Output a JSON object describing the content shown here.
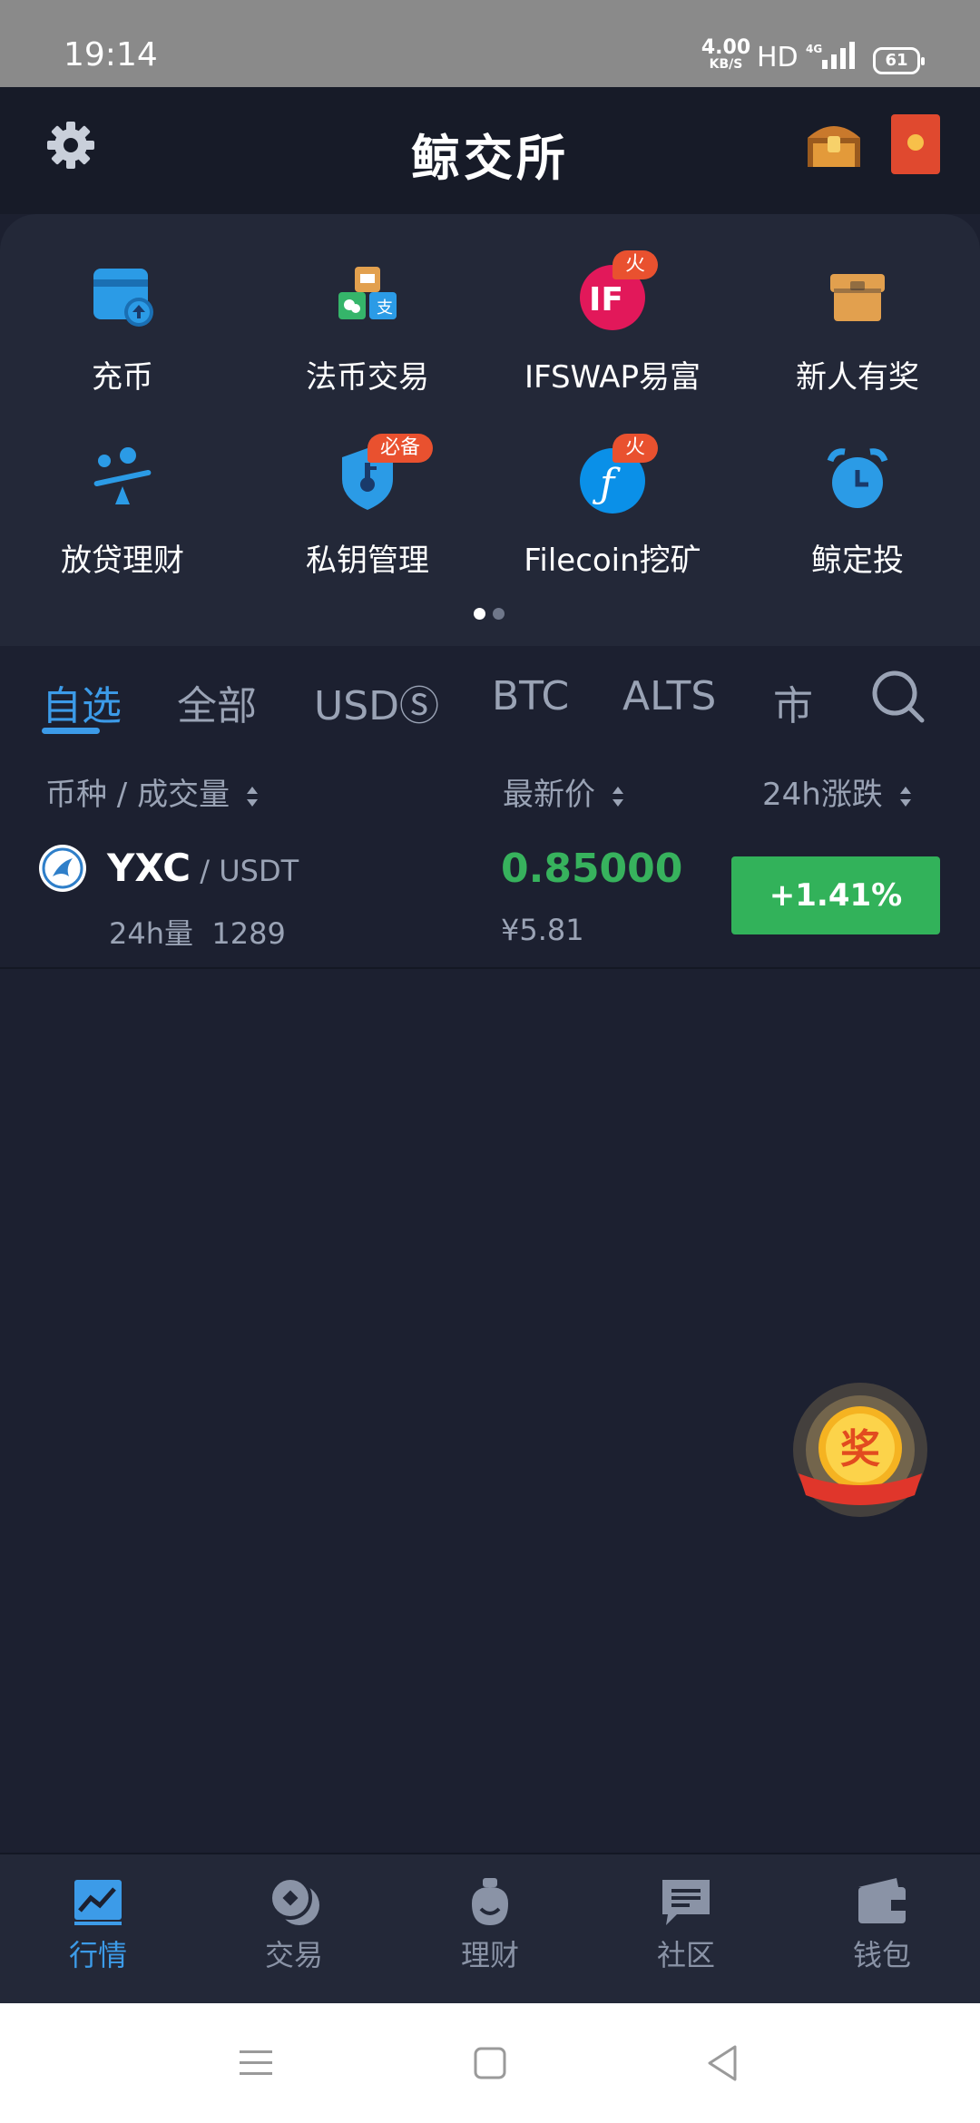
{
  "status_bar": {
    "time": "19:14",
    "net_speed": "4.00",
    "net_unit": "KB/S",
    "hd": "HD",
    "network": "4G",
    "battery": "61"
  },
  "header": {
    "title": "鲸交所",
    "settings_icon": "gear-icon",
    "chest_icon": "treasure-chest-icon",
    "envelope_icon": "red-envelope-icon"
  },
  "quick_menu": {
    "items": [
      {
        "label": "充币",
        "icon": "deposit-card-icon",
        "badge": ""
      },
      {
        "label": "法币交易",
        "icon": "fiat-exchange-icon",
        "badge": ""
      },
      {
        "label": "IFSWAP易富",
        "icon": "ifswap-logo-icon",
        "badge": "火"
      },
      {
        "label": "新人有奖",
        "icon": "gift-box-icon",
        "badge": ""
      },
      {
        "label": "放贷理财",
        "icon": "lending-icon",
        "badge": ""
      },
      {
        "label": "私钥管理",
        "icon": "key-shield-icon",
        "badge": "必备"
      },
      {
        "label": "Filecoin挖矿",
        "icon": "filecoin-logo-icon",
        "badge": "火"
      },
      {
        "label": "鲸定投",
        "icon": "alarm-clock-icon",
        "badge": ""
      }
    ],
    "page_count": 2,
    "current_page": 1
  },
  "tabs": [
    {
      "label": "自选",
      "active": true
    },
    {
      "label": "全部",
      "active": false
    },
    {
      "label": "USDⓈ",
      "active": false
    },
    {
      "label": "BTC",
      "active": false
    },
    {
      "label": "ALTS",
      "active": false
    },
    {
      "label": "市",
      "active": false
    }
  ],
  "list_header": {
    "col1": "币种 / 成交量",
    "col2": "最新价",
    "col3": "24h涨跌"
  },
  "rows": [
    {
      "symbol": "YXC",
      "pair": " / USDT",
      "volume_label": "24h量",
      "volume": "1289",
      "price": "0.85000",
      "fiat_price": "¥5.81",
      "change": "+1.41%"
    }
  ],
  "floating": {
    "award_label": "奖"
  },
  "bottom_nav": [
    {
      "label": "行情",
      "icon": "chart-icon",
      "active": true
    },
    {
      "label": "交易",
      "icon": "trade-coin-icon",
      "active": false
    },
    {
      "label": "理财",
      "icon": "money-bag-icon",
      "active": false
    },
    {
      "label": "社区",
      "icon": "chat-icon",
      "active": false
    },
    {
      "label": "钱包",
      "icon": "wallet-icon",
      "active": false
    }
  ],
  "colors": {
    "accent": "#3c9be8",
    "up": "#32b25a",
    "background": "#1c2030",
    "panel": "#232838",
    "badge": "#e9512f"
  }
}
